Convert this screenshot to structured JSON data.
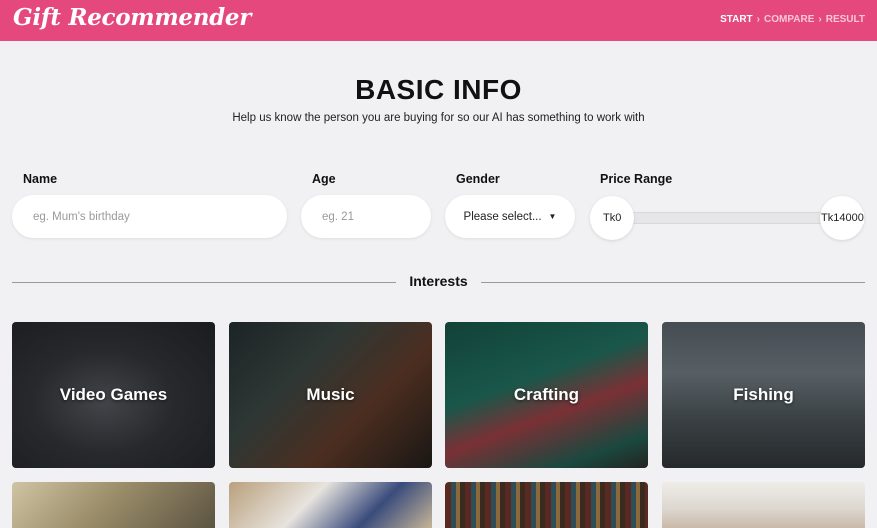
{
  "header": {
    "logo": "Gift Recommender",
    "steps": [
      {
        "label": "START",
        "active": true
      },
      {
        "label": "COMPARE",
        "active": false
      },
      {
        "label": "RESULT",
        "active": false
      }
    ],
    "step_separator": "›"
  },
  "page": {
    "title": "BASIC INFO",
    "subtitle": "Help us know the person you are buying for so our AI has something to work with"
  },
  "form": {
    "name": {
      "label": "Name",
      "placeholder": "eg. Mum's birthday",
      "value": ""
    },
    "age": {
      "label": "Age",
      "placeholder": "eg. 21",
      "value": ""
    },
    "gender": {
      "label": "Gender",
      "selected": "Please select..."
    },
    "price_range": {
      "label": "Price Range",
      "min_label": "Tk0",
      "max_label": "Tk14000",
      "min": 0,
      "max": 14000
    }
  },
  "interests": {
    "heading": "Interests",
    "cards": [
      {
        "label": "Video Games"
      },
      {
        "label": "Music"
      },
      {
        "label": "Crafting"
      },
      {
        "label": "Fishing"
      },
      {
        "label": ""
      },
      {
        "label": ""
      },
      {
        "label": ""
      },
      {
        "label": ""
      }
    ]
  }
}
